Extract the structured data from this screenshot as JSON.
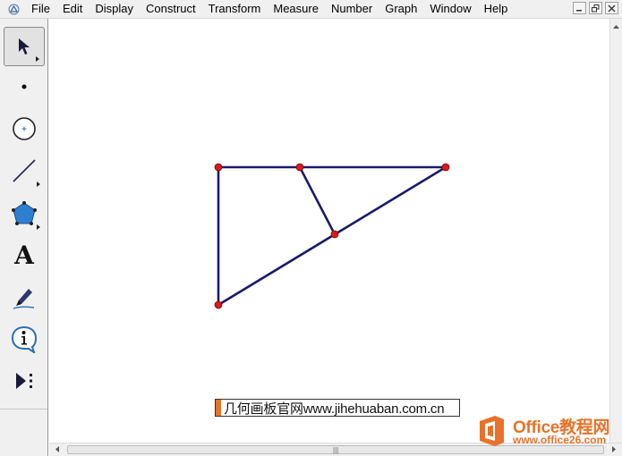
{
  "menu": {
    "items": [
      {
        "id": "file",
        "label": "File"
      },
      {
        "id": "edit",
        "label": "Edit"
      },
      {
        "id": "display",
        "label": "Display"
      },
      {
        "id": "construct",
        "label": "Construct"
      },
      {
        "id": "transform",
        "label": "Transform"
      },
      {
        "id": "measure",
        "label": "Measure"
      },
      {
        "id": "number",
        "label": "Number"
      },
      {
        "id": "graph",
        "label": "Graph"
      },
      {
        "id": "window",
        "label": "Window"
      },
      {
        "id": "help",
        "label": "Help"
      }
    ]
  },
  "window_controls": [
    "minimize-icon",
    "restore-icon",
    "close-icon"
  ],
  "toolbox": {
    "tools": [
      {
        "id": "arrow",
        "icon": "arrow-select-icon",
        "selected": true
      },
      {
        "id": "point",
        "icon": "point-icon"
      },
      {
        "id": "compass",
        "icon": "compass-circle-icon"
      },
      {
        "id": "straightedge",
        "icon": "straightedge-icon"
      },
      {
        "id": "polygon",
        "icon": "polygon-icon"
      },
      {
        "id": "text",
        "icon": "text-icon",
        "glyph": "A"
      },
      {
        "id": "marker",
        "icon": "marker-icon"
      },
      {
        "id": "information",
        "icon": "information-icon"
      },
      {
        "id": "custom",
        "icon": "custom-tool-icon"
      }
    ]
  },
  "banner": {
    "text": "几何画板官网www.jihehuaban.com.cn"
  },
  "watermark": {
    "brand": "Office教程网",
    "url": "www.office26.com"
  },
  "colors": {
    "segment": "#1a1a6e",
    "point": "#d61c1c",
    "point_stroke": "#7a0c0c",
    "accent": "#e8722a"
  }
}
